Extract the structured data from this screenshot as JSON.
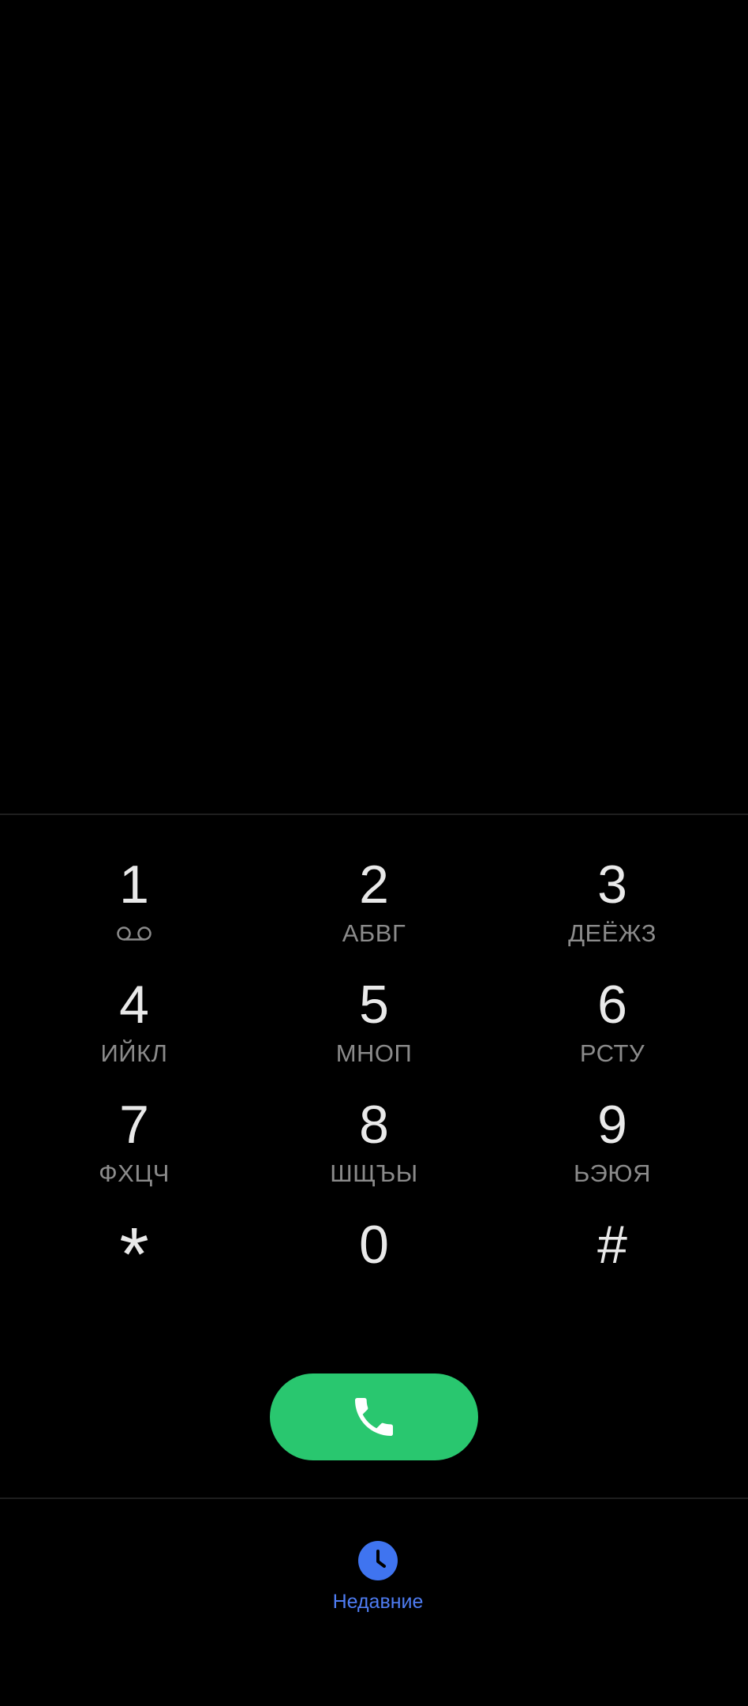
{
  "dialpad": {
    "keys": [
      {
        "digit": "1",
        "letters": "",
        "sub_icon": "voicemail-icon"
      },
      {
        "digit": "2",
        "letters": "АБВГ"
      },
      {
        "digit": "3",
        "letters": "ДЕЁЖЗ"
      },
      {
        "digit": "4",
        "letters": "ИЙКЛ"
      },
      {
        "digit": "5",
        "letters": "МНОП"
      },
      {
        "digit": "6",
        "letters": "РСТУ"
      },
      {
        "digit": "7",
        "letters": "ФХЦЧ"
      },
      {
        "digit": "8",
        "letters": "ШЩЪЫ"
      },
      {
        "digit": "9",
        "letters": "ЬЭЮЯ"
      },
      {
        "digit": "*",
        "letters": ""
      },
      {
        "digit": "0",
        "letters": ""
      },
      {
        "digit": "#",
        "letters": ""
      }
    ]
  },
  "call_button": {
    "icon": "phone-icon",
    "color": "#29c76f"
  },
  "bottom_nav": {
    "recents": {
      "label": "Недавние",
      "icon": "clock-icon",
      "color": "#4e7cf2"
    }
  },
  "colors": {
    "background": "#000000",
    "digit_text": "#e9e9e9",
    "letters_text": "#8b8b8b",
    "divider": "#1e1e1e"
  }
}
